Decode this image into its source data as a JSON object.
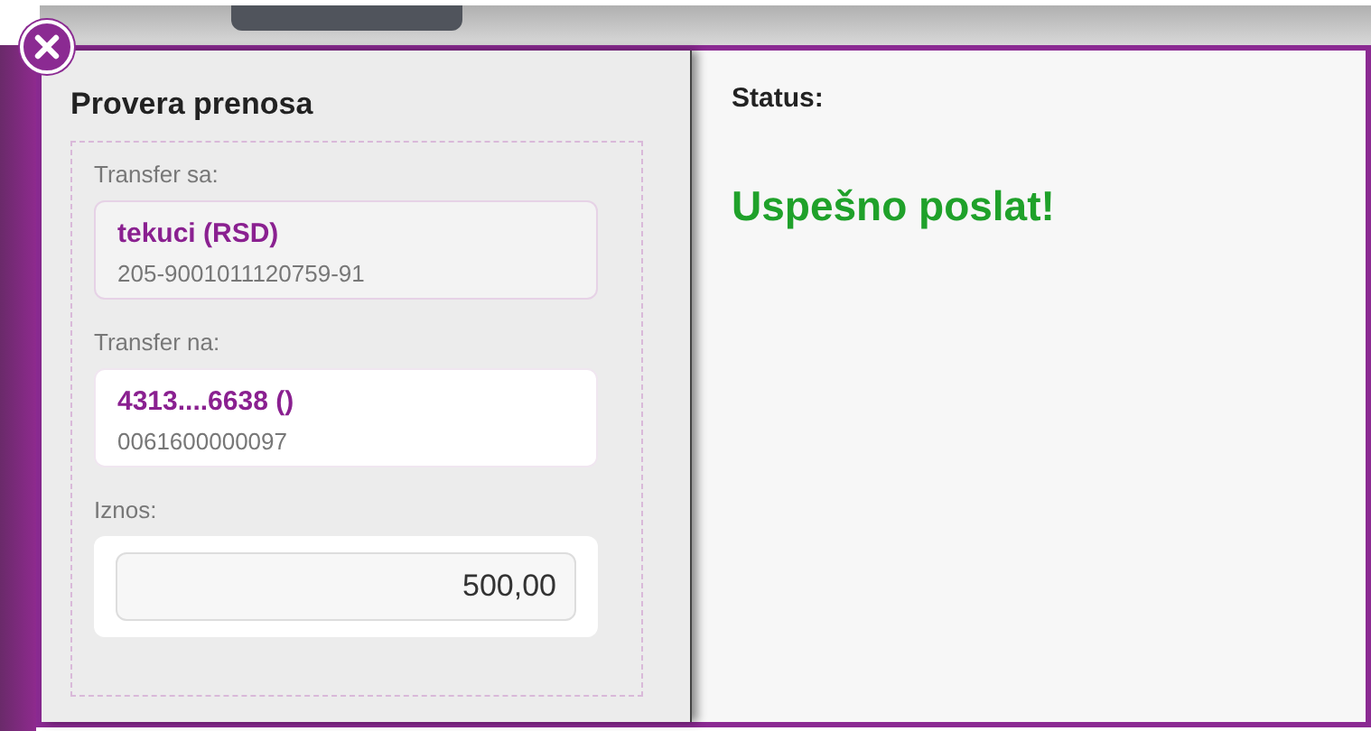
{
  "transfer_check": {
    "title": "Provera prenosa",
    "accounts": [
      {
        "kind": "source",
        "label": "Transfer sa:",
        "name": "tekuci (RSD)",
        "number": "205-9001011120759-91"
      },
      {
        "kind": "destination",
        "label": "Transfer na:",
        "name": "4313....6638 ()",
        "number": "0061600000097"
      }
    ],
    "amount": {
      "label": "Iznos:",
      "value": "500,00"
    }
  },
  "status": {
    "label": "Status:",
    "message": "Uspešno poslat!"
  }
}
